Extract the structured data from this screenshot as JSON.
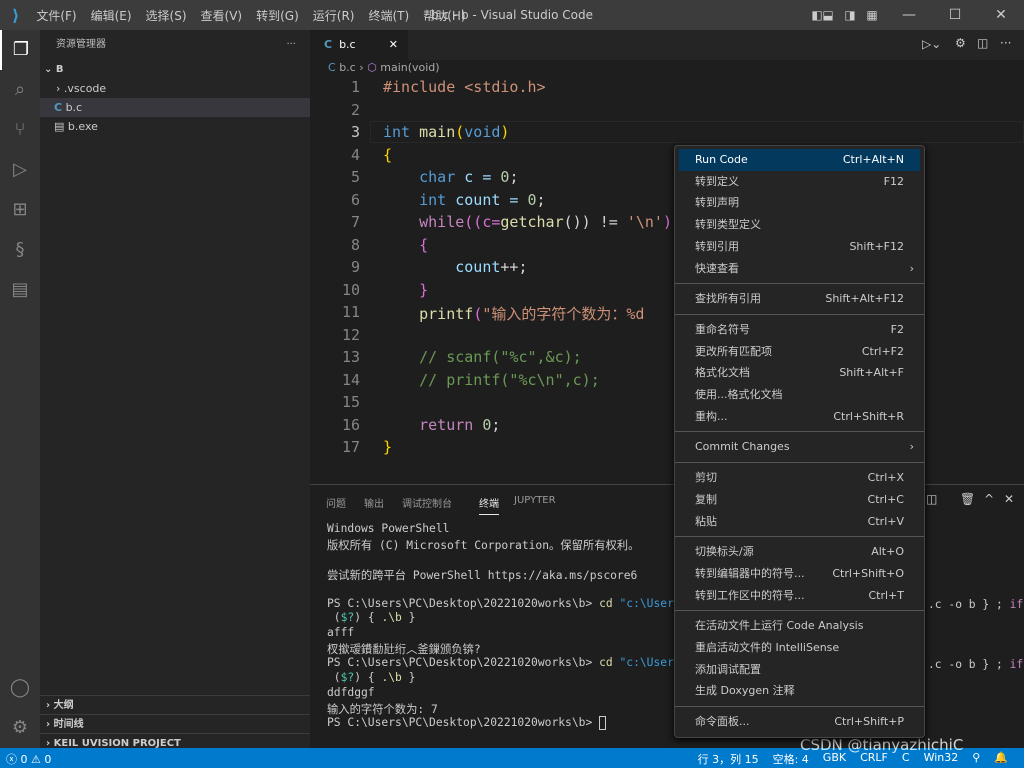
{
  "window": {
    "title": "b.c - b - Visual Studio Code",
    "menus": [
      "文件(F)",
      "编辑(E)",
      "选择(S)",
      "查看(V)",
      "转到(G)",
      "运行(R)",
      "终端(T)",
      "帮助(H)"
    ]
  },
  "sidebar": {
    "title": "资源管理器",
    "folder": "B",
    "items": [
      {
        "label": ".vscode",
        "type": "folder"
      },
      {
        "label": "b.c",
        "type": "c"
      },
      {
        "label": "b.exe",
        "type": "exe"
      }
    ],
    "sections": [
      "大纲",
      "时间线",
      "KEIL UVISION PROJECT"
    ]
  },
  "editor": {
    "tab": "b.c",
    "breadcrumb": [
      "b.c",
      "main(void)"
    ],
    "lines": [
      [
        [
          "#include <stdio.h>",
          "#ce9178"
        ]
      ],
      [],
      [
        [
          "int",
          "#569cd6"
        ],
        [
          " ",
          ""
        ],
        [
          "main",
          "#dcdcaa"
        ],
        [
          "(",
          "#ffd700"
        ],
        [
          "void",
          "#569cd6"
        ],
        [
          ")",
          "#ffd700"
        ]
      ],
      [
        [
          "{",
          "#ffd700"
        ]
      ],
      [
        [
          "    ",
          ""
        ],
        [
          "char",
          "#569cd6"
        ],
        [
          " c = ",
          "#9cdcfe"
        ],
        [
          "0",
          "#b5cea8"
        ],
        [
          ";",
          ""
        ]
      ],
      [
        [
          "    ",
          ""
        ],
        [
          "int",
          "#569cd6"
        ],
        [
          " count = ",
          "#9cdcfe"
        ],
        [
          "0",
          "#b5cea8"
        ],
        [
          ";",
          ""
        ]
      ],
      [
        [
          "    ",
          ""
        ],
        [
          "while",
          "#c586c0"
        ],
        [
          "((c=",
          "#da70d6"
        ],
        [
          "getchar",
          "#dcdcaa"
        ],
        [
          "()) != ",
          "#d4d4d4"
        ],
        [
          "'\\n'",
          "#ce9178"
        ],
        [
          ")",
          "#da70d6"
        ]
      ],
      [
        [
          "    ",
          ""
        ],
        [
          "{",
          "#da70d6"
        ]
      ],
      [
        [
          "        ",
          ""
        ],
        [
          "count",
          "#9cdcfe"
        ],
        [
          "++;",
          ""
        ]
      ],
      [
        [
          "    ",
          ""
        ],
        [
          "}",
          "#da70d6"
        ]
      ],
      [
        [
          "    ",
          ""
        ],
        [
          "printf",
          "#dcdcaa"
        ],
        [
          "(",
          "#da70d6"
        ],
        [
          "\"输入的字符个数为：%d",
          "#ce9178"
        ]
      ],
      [],
      [
        [
          "    // scanf(\"%c\",&c);",
          "#6a9955"
        ]
      ],
      [
        [
          "    // printf(\"%c\\n\",c);",
          "#6a9955"
        ]
      ],
      [],
      [
        [
          "    ",
          ""
        ],
        [
          "return",
          "#c586c0"
        ],
        [
          " ",
          ""
        ],
        [
          "0",
          "#b5cea8"
        ],
        [
          ";",
          ""
        ]
      ],
      [
        [
          "}",
          "#ffd700"
        ]
      ]
    ]
  },
  "panel": {
    "tabs": [
      "问题",
      "输出",
      "调试控制台",
      "终端",
      "JUPYTER"
    ],
    "active": "终端",
    "terminal": [
      [
        [
          "Windows PowerShell",
          ""
        ]
      ],
      [
        [
          "版权所有 (C) Microsoft Corporation。保留所有权利。",
          ""
        ]
      ],
      [],
      [
        [
          "尝试新的跨平台 PowerShell https://aka.ms/pscore6",
          ""
        ]
      ],
      [],
      [
        [
          "PS C:\\Users\\PC\\Desktop\\20221020works\\b> ",
          ""
        ],
        [
          "cd ",
          "#dcdcaa"
        ],
        [
          "\"c:\\Users\\PC\\De",
          "#3b9cd9"
        ]
      ],
      [
        [
          " (",
          ""
        ],
        [
          "$?",
          "#4ec9b0"
        ],
        [
          ") { ",
          ""
        ],
        [
          ".\\b",
          "#dcdcaa"
        ],
        [
          " }",
          ""
        ]
      ],
      [
        [
          "afff",
          ""
        ]
      ],
      [
        [
          "杈撳叆鐨勫瓧绗︿釜鏁颁负锛?",
          ""
        ]
      ],
      [
        [
          "PS C:\\Users\\PC\\Desktop\\20221020works\\b> ",
          ""
        ],
        [
          "cd ",
          "#dcdcaa"
        ],
        [
          "\"c:\\Users\\PC\\De",
          "#3b9cd9"
        ]
      ],
      [
        [
          " (",
          ""
        ],
        [
          "$?",
          "#4ec9b0"
        ],
        [
          ") { ",
          ""
        ],
        [
          ".\\b",
          "#dcdcaa"
        ],
        [
          " }",
          ""
        ]
      ],
      [
        [
          "ddfdggf",
          ""
        ]
      ],
      [
        [
          "输入的字符个数为: 7",
          ""
        ]
      ],
      [
        [
          "PS C:\\Users\\PC\\Desktop\\20221020works\\b> ",
          ""
        ]
      ]
    ],
    "terminal_right": [
      ".c -o b } ; ",
      "if"
    ]
  },
  "context_menu": {
    "groups": [
      [
        {
          "label": "Run Code",
          "shortcut": "Ctrl+Alt+N",
          "selected": true
        },
        {
          "label": "转到定义",
          "shortcut": "F12"
        },
        {
          "label": "转到声明",
          "shortcut": ""
        },
        {
          "label": "转到类型定义",
          "shortcut": ""
        },
        {
          "label": "转到引用",
          "shortcut": "Shift+F12"
        },
        {
          "label": "快速查看",
          "shortcut": "",
          "submenu": true
        }
      ],
      [
        {
          "label": "查找所有引用",
          "shortcut": "Shift+Alt+F12"
        }
      ],
      [
        {
          "label": "重命名符号",
          "shortcut": "F2"
        },
        {
          "label": "更改所有匹配项",
          "shortcut": "Ctrl+F2"
        },
        {
          "label": "格式化文档",
          "shortcut": "Shift+Alt+F"
        },
        {
          "label": "使用...格式化文档",
          "shortcut": ""
        },
        {
          "label": "重构...",
          "shortcut": "Ctrl+Shift+R"
        }
      ],
      [
        {
          "label": "Commit Changes",
          "shortcut": "",
          "submenu": true
        }
      ],
      [
        {
          "label": "剪切",
          "shortcut": "Ctrl+X"
        },
        {
          "label": "复制",
          "shortcut": "Ctrl+C"
        },
        {
          "label": "粘贴",
          "shortcut": "Ctrl+V"
        }
      ],
      [
        {
          "label": "切换标头/源",
          "shortcut": "Alt+O"
        },
        {
          "label": "转到编辑器中的符号...",
          "shortcut": "Ctrl+Shift+O"
        },
        {
          "label": "转到工作区中的符号...",
          "shortcut": "Ctrl+T"
        }
      ],
      [
        {
          "label": "在活动文件上运行 Code Analysis",
          "shortcut": ""
        },
        {
          "label": "重启活动文件的 IntelliSense",
          "shortcut": ""
        },
        {
          "label": "添加调试配置",
          "shortcut": ""
        },
        {
          "label": "生成 Doxygen 注释",
          "shortcut": ""
        }
      ],
      [
        {
          "label": "命令面板...",
          "shortcut": "Ctrl+Shift+P"
        }
      ]
    ]
  },
  "status": {
    "errors": "0",
    "warnings": "0",
    "right": [
      "行 3，列 15",
      "空格: 4",
      "GBK",
      "CRLF",
      "C",
      "Win32"
    ]
  },
  "watermark": "CSDN @tianyazhichiC"
}
